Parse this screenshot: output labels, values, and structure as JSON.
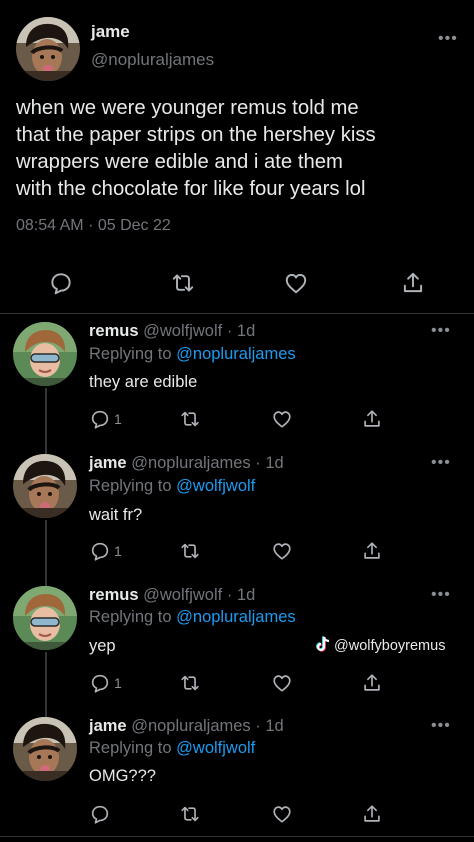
{
  "main_tweet": {
    "display_name": "jame",
    "handle": "@nopluraljames",
    "text_lines": [
      "when we were younger remus told me",
      "that the paper strips on the hershey kiss",
      "wrappers were edible and i ate them",
      "with the chocolate for like four years lol"
    ],
    "time": "08:54 AM",
    "separator": "·",
    "date": "05 Dec 22"
  },
  "replies": [
    {
      "display_name": "remus",
      "handle": "@wolfjwolf",
      "age": "1d",
      "replying_prefix": "Replying to",
      "replying_to": "@nopluraljames",
      "text": "they are edible",
      "reply_count": "1"
    },
    {
      "display_name": "jame",
      "handle": "@nopluraljames",
      "age": "1d",
      "replying_prefix": "Replying to",
      "replying_to": "@wolfjwolf",
      "text": "wait fr?",
      "reply_count": "1"
    },
    {
      "display_name": "remus",
      "handle": "@wolfjwolf",
      "age": "1d",
      "replying_prefix": "Replying to",
      "replying_to": "@nopluraljames",
      "text": "yep",
      "reply_count": "1"
    },
    {
      "display_name": "jame",
      "handle": "@nopluraljames",
      "age": "1d",
      "replying_prefix": "Replying to",
      "replying_to": "@wolfjwolf",
      "text": "OMG???",
      "reply_count": ""
    }
  ],
  "watermark": {
    "handle": "@wolfyboyremus",
    "icon": "tiktok-icon"
  },
  "icons": {
    "reply": "reply-icon",
    "retweet": "retweet-icon",
    "like": "heart-icon",
    "share": "share-icon",
    "more": "more-icon"
  },
  "colors": {
    "background": "#000000",
    "text": "#e7e9ea",
    "muted": "#71767b",
    "link": "#1d9bf0"
  }
}
